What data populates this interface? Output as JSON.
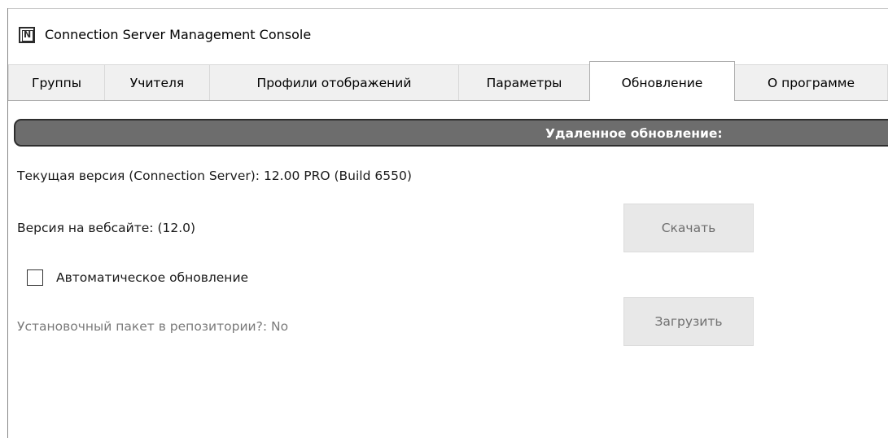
{
  "window": {
    "title": "Connection Server Management Console",
    "icon": "app-n-icon",
    "icon_glyph": "N"
  },
  "tabs": [
    {
      "label": "Группы",
      "active": false
    },
    {
      "label": "Учителя",
      "active": false
    },
    {
      "label": "Профили отображений",
      "active": false
    },
    {
      "label": "Параметры",
      "active": false
    },
    {
      "label": "Обновление",
      "active": true
    },
    {
      "label": "О программе",
      "active": false
    }
  ],
  "section": {
    "header": "Удаленное обновление:"
  },
  "update": {
    "current_version_label": "Текущая версия (Connection Server): 12.00 PRO (Build 6550)",
    "website_version_label": "Версия на вебсайте:  (12.0)",
    "download_button": "Скачать",
    "auto_update_label": "Автоматическое обновление",
    "auto_update_checked": false,
    "repository_label": "Установочный пакет в репозитории?:  No",
    "load_button": "Загрузить"
  },
  "colors": {
    "header_bg": "#6d6d6d",
    "header_text": "#ffffff",
    "tab_bg": "#f0f0f0",
    "tab_active_bg": "#ffffff",
    "button_bg": "#e8e8e8",
    "disabled_text": "#7a7a7a"
  }
}
